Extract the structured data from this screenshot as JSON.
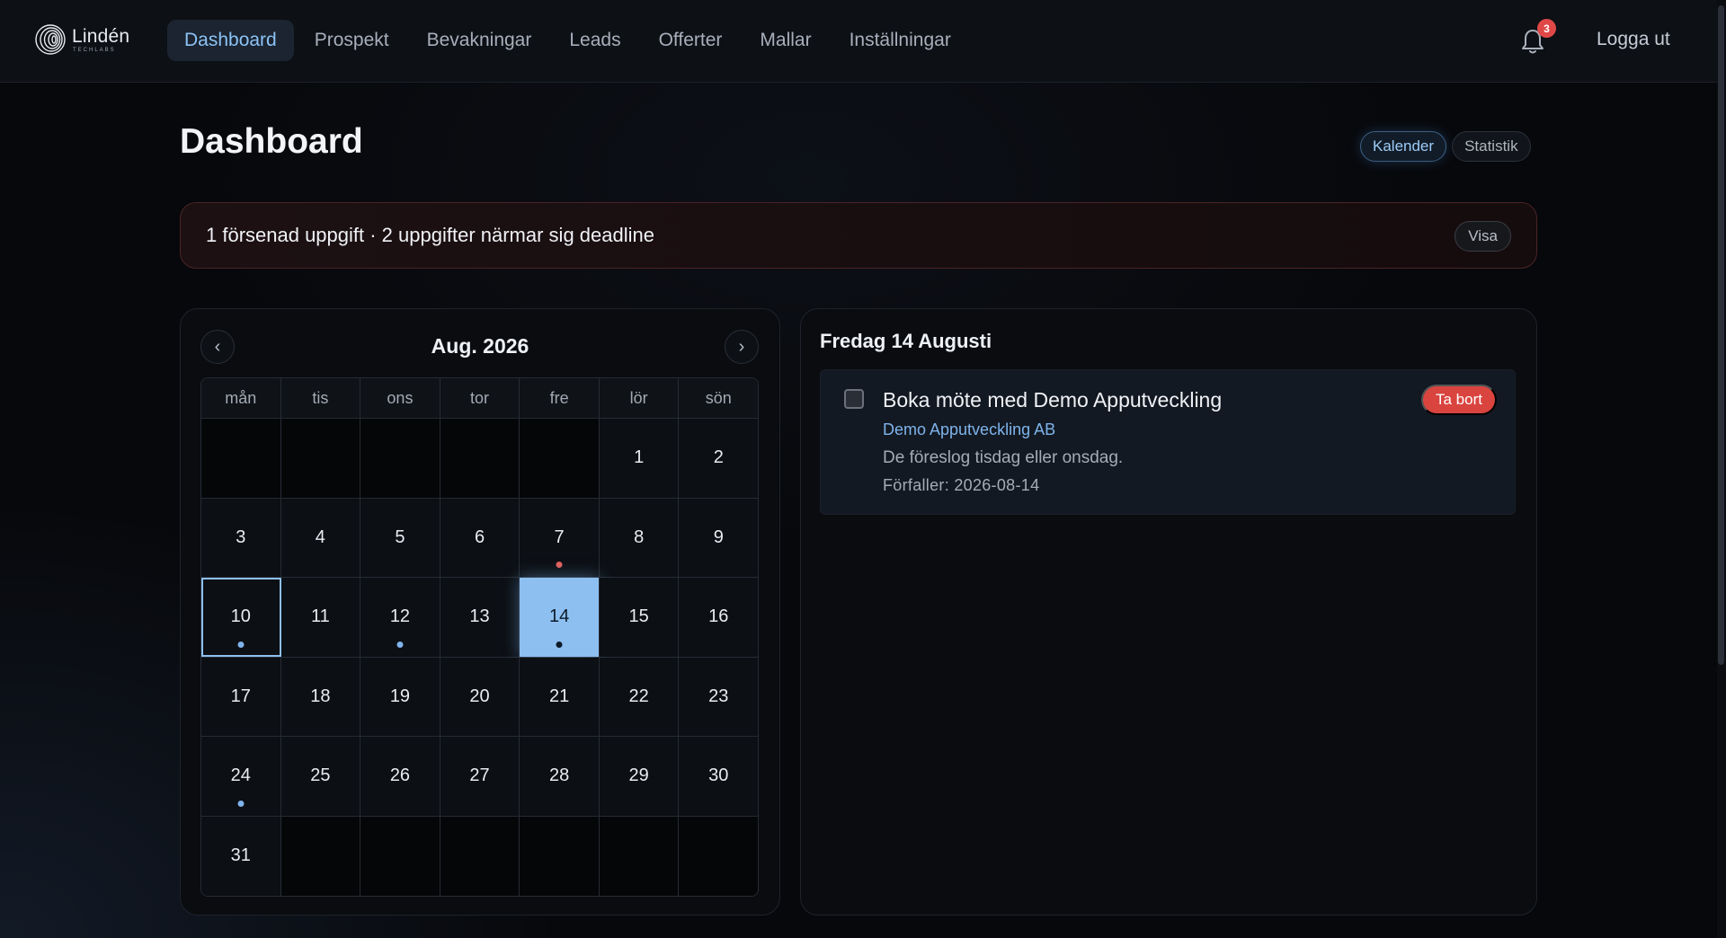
{
  "nav": {
    "logo_name": "Lindén",
    "logo_sub": "TECHLABS",
    "items": [
      {
        "label": "Dashboard",
        "active": true
      },
      {
        "label": "Prospekt"
      },
      {
        "label": "Bevakningar"
      },
      {
        "label": "Leads"
      },
      {
        "label": "Offerter"
      },
      {
        "label": "Mallar"
      },
      {
        "label": "Inställningar"
      }
    ],
    "notification_count": "3",
    "logout_label": "Logga ut"
  },
  "page": {
    "title": "Dashboard",
    "view_toggle": {
      "active": "Kalender",
      "other": "Statistik"
    }
  },
  "alert": {
    "text": "1 försenad uppgift · 2 uppgifter närmar sig deadline",
    "button": "Visa"
  },
  "calendar": {
    "month_label": "Aug. 2026",
    "prev_symbol": "‹",
    "next_symbol": "›",
    "weekdays": [
      "mån",
      "tis",
      "ons",
      "tor",
      "fre",
      "lör",
      "sön"
    ],
    "weeks": [
      [
        null,
        null,
        null,
        null,
        null,
        "1",
        "2"
      ],
      [
        "3",
        "4",
        "5",
        "6",
        "7",
        "8",
        "9"
      ],
      [
        "10",
        "11",
        "12",
        "13",
        "14",
        "15",
        "16"
      ],
      [
        "17",
        "18",
        "19",
        "20",
        "21",
        "22",
        "23"
      ],
      [
        "24",
        "25",
        "26",
        "27",
        "28",
        "29",
        "30"
      ],
      [
        "31",
        null,
        null,
        null,
        null,
        null,
        null
      ]
    ],
    "today": "10",
    "selected": "14",
    "markers": {
      "7": "red",
      "10": "blue",
      "12": "blue",
      "14": "dark",
      "24": "blue"
    },
    "colors": {
      "accent": "#8dbff0",
      "overdue": "#e0605b",
      "event": "#7fb4ec"
    }
  },
  "day_panel": {
    "title": "Fredag 14 Augusti",
    "task": {
      "title": "Boka möte med Demo Apputveckling",
      "company": "Demo Apputveckling AB",
      "description": "De föreslog tisdag eller onsdag.",
      "due": "Förfaller: 2026-08-14",
      "delete_label": "Ta bort",
      "checked": false
    }
  }
}
